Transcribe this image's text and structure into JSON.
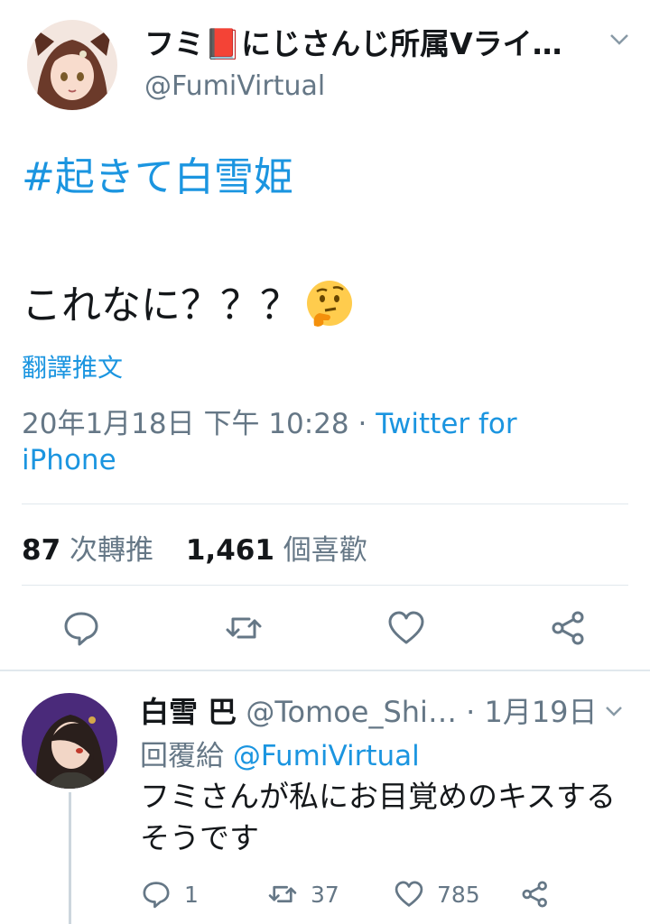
{
  "tweet": {
    "display_name": "フミ📕にじさんじ所属Vライ…",
    "handle": "@FumiVirtual",
    "hashtag": "#起きて白雪姫",
    "body": "これなに？？？",
    "emoji": "thinking-face-icon",
    "translate_label": "翻譯推文",
    "timestamp": "20年1月18日 下午 10:28 · ",
    "source_line1": "Twitter for",
    "source_line2": "iPhone",
    "retweet_count": "87",
    "retweet_label": "次轉推",
    "like_count": "1,461",
    "like_label": "個喜歡"
  },
  "reply": {
    "name": "白雪 巴",
    "handle": "@Tomoe_Shi…",
    "date": "· 1月19日",
    "replying_prefix": "回覆給",
    "replying_to": "@FumiVirtual",
    "body": "フミさんが私にお目覚めのキスするそうです",
    "reply_count": "1",
    "retweet_count": "37",
    "like_count": "785"
  },
  "colors": {
    "link": "#1b95e0",
    "secondary_text": "#657786",
    "divider": "#e1e8ed"
  }
}
